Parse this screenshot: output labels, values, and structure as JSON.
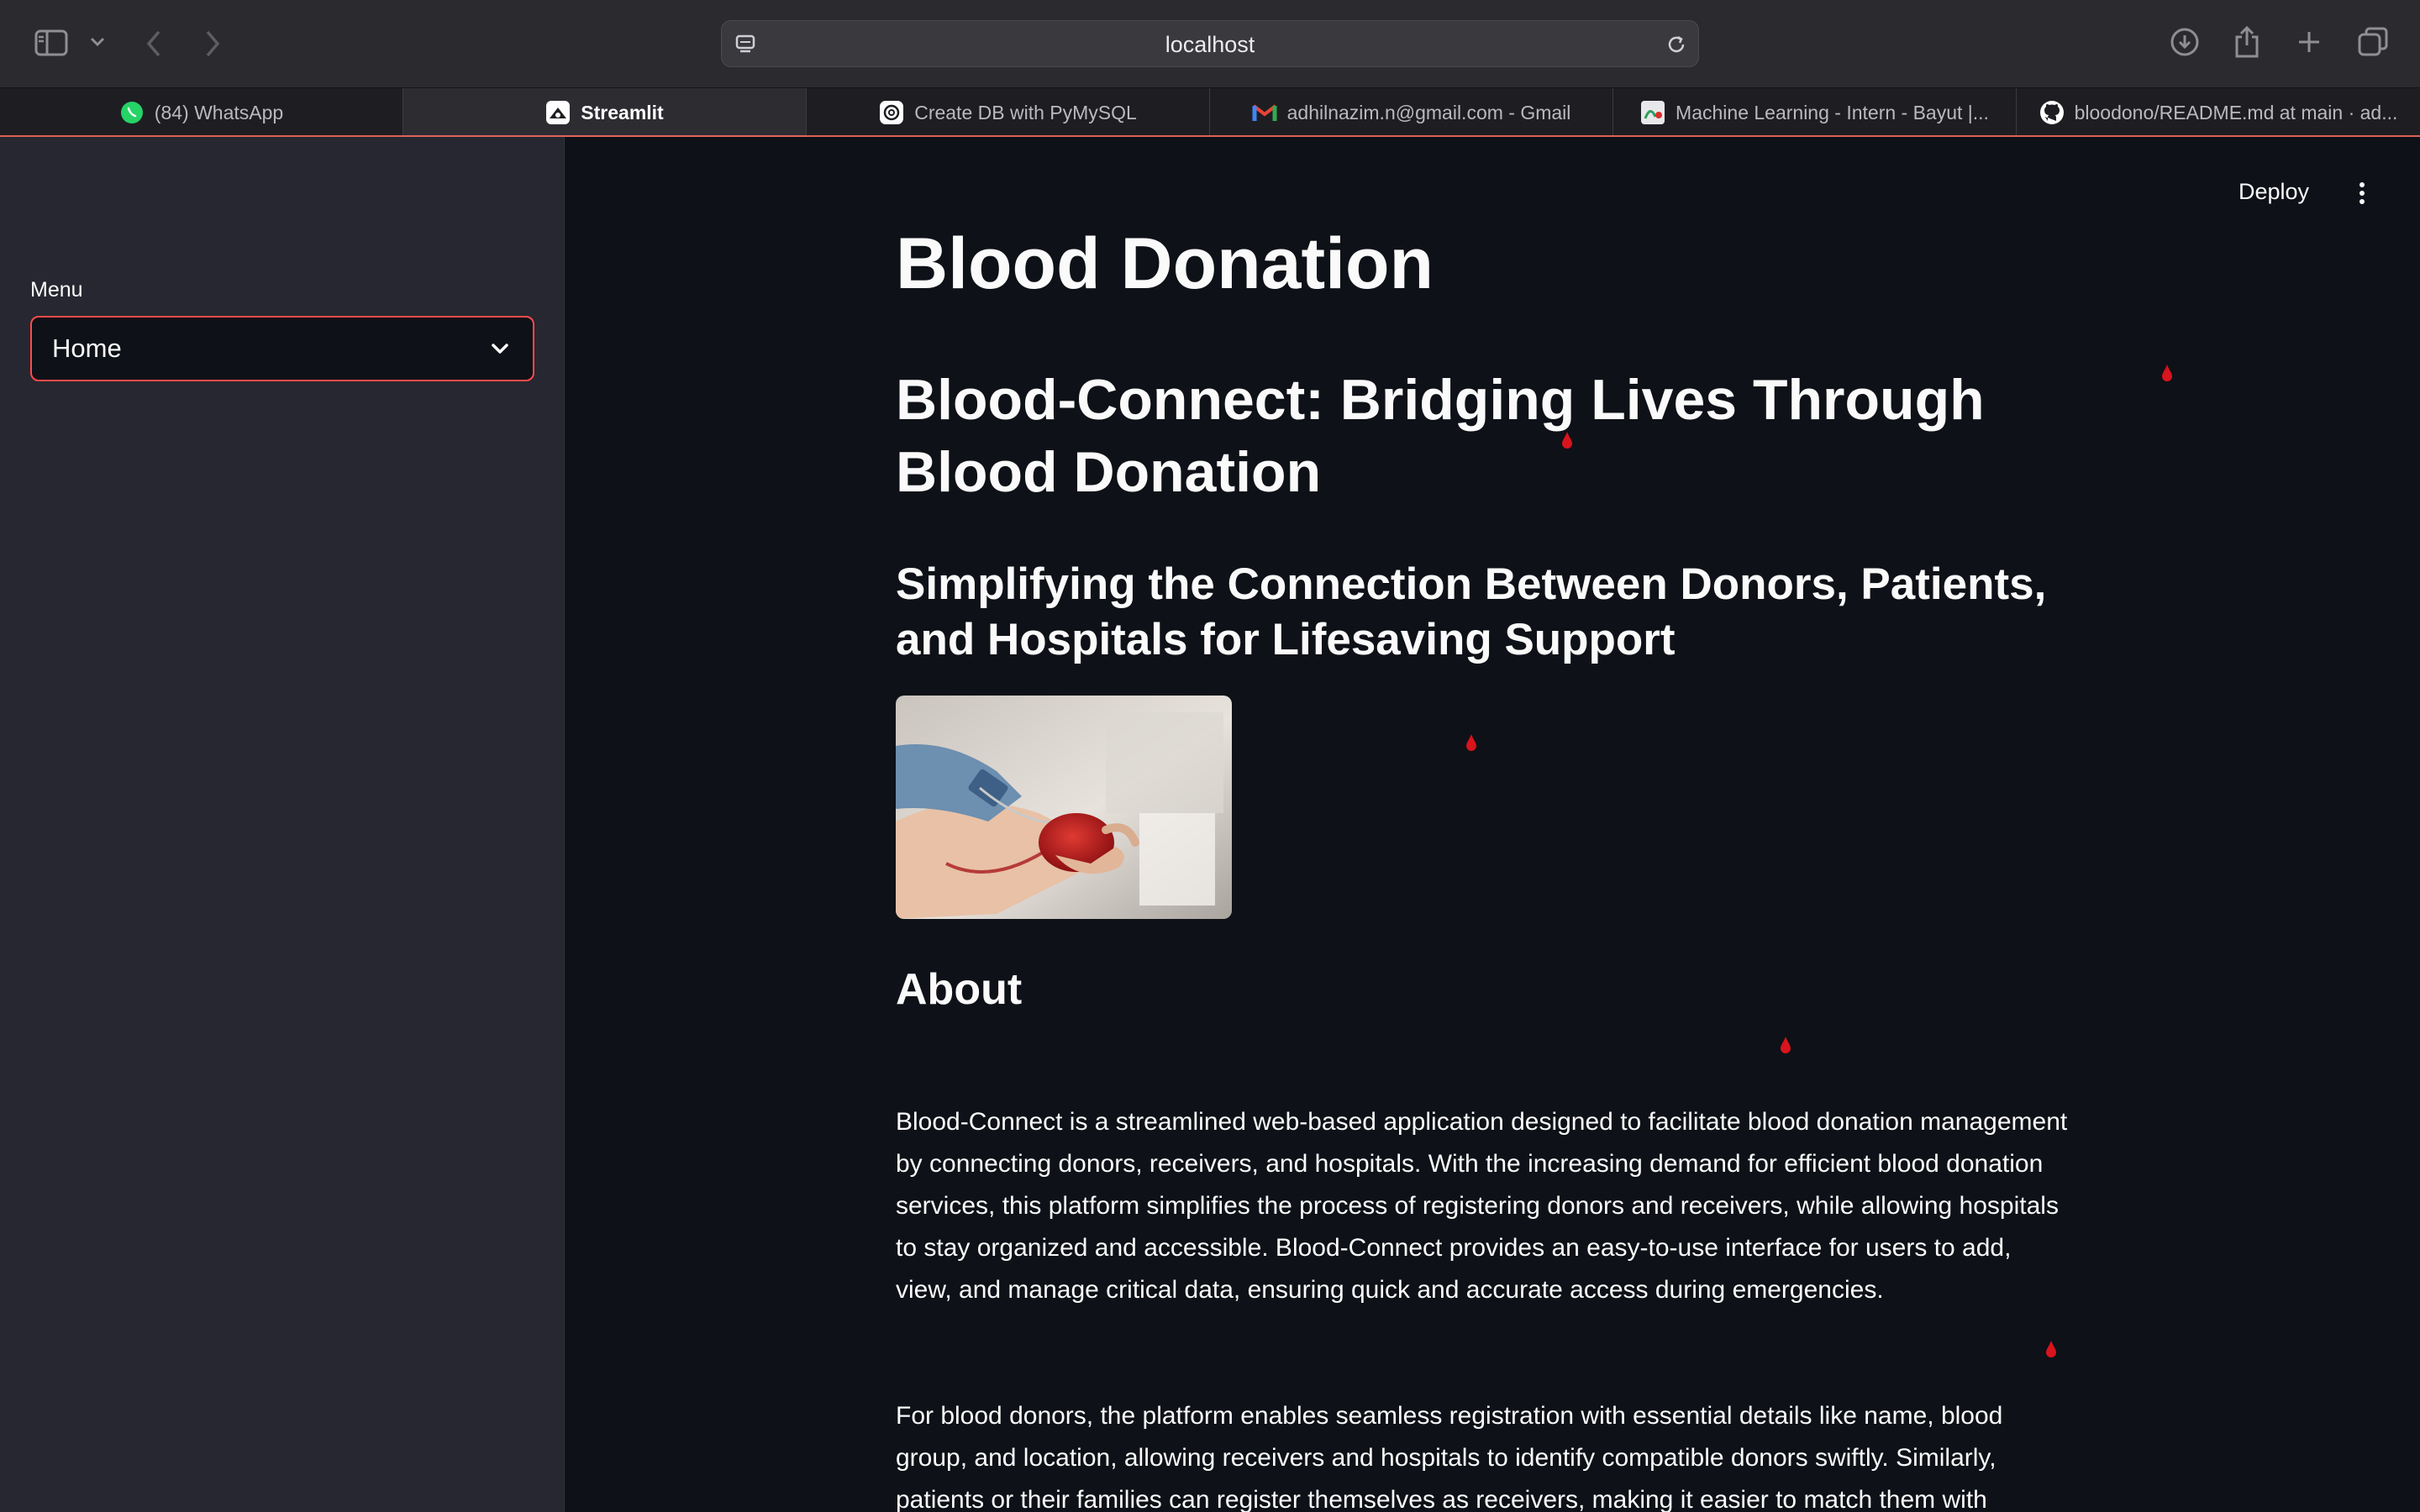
{
  "browser": {
    "address": "localhost"
  },
  "tabs": [
    {
      "label": "(84) WhatsApp",
      "icon": "whatsapp-icon",
      "active": false
    },
    {
      "label": "Streamlit",
      "icon": "streamlit-icon",
      "active": true
    },
    {
      "label": "Create DB with PyMySQL",
      "icon": "openai-icon",
      "active": false
    },
    {
      "label": "adhilnazim.n@gmail.com - Gmail",
      "icon": "gmail-icon",
      "active": false
    },
    {
      "label": "Machine Learning - Intern - Bayut |...",
      "icon": "bayut-icon",
      "active": false
    },
    {
      "label": "bloodono/README.md at main · ad...",
      "icon": "github-icon",
      "active": false
    }
  ],
  "sidebar": {
    "menu_label": "Menu",
    "selected": "Home"
  },
  "header": {
    "deploy_label": "Deploy"
  },
  "main": {
    "title": "Blood Donation",
    "subtitle": "Blood-Connect: Bridging Lives Through Blood Donation",
    "tagline": "Simplifying the Connection Between Donors, Patients, and Hospitals for Lifesaving Support",
    "about_heading": "About",
    "paragraph1": "Blood-Connect is a streamlined web-based application designed to facilitate blood donation management by connecting donors, receivers, and hospitals. With the increasing demand for efficient blood donation services, this platform simplifies the process of registering donors and receivers, while allowing hospitals to stay organized and accessible. Blood-Connect provides an easy-to-use interface for users to add, view, and manage critical data, ensuring quick and accurate access during emergencies.",
    "paragraph2": "For blood donors, the platform enables seamless registration with essential details like name, blood group, and location, allowing receivers and hospitals to identify compatible donors swiftly. Similarly, patients or their families can register themselves as receivers, making it easier to match them with"
  },
  "colors": {
    "accent": "#ff4b4b",
    "background": "#0e1117",
    "sidebar": "#262730",
    "drop": "#d8141c"
  }
}
